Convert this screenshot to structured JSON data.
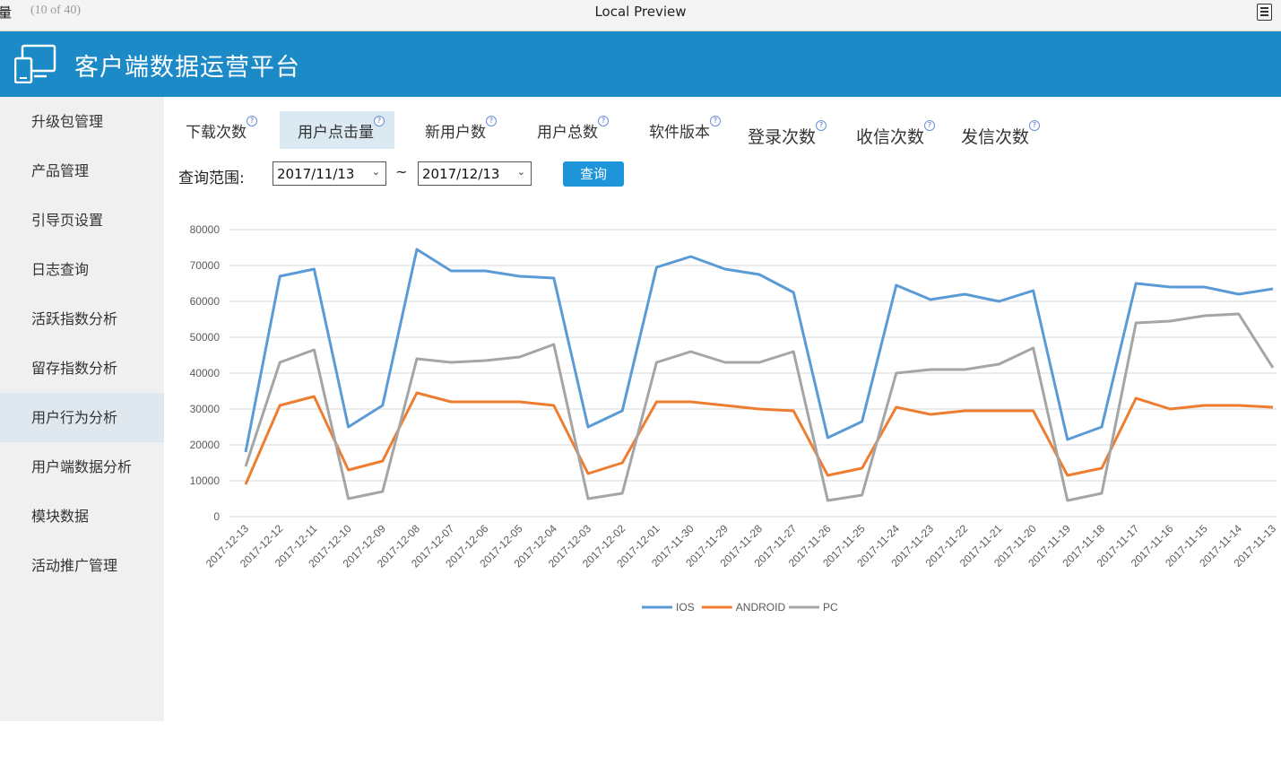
{
  "preview_bar": {
    "title_fragment": "量",
    "count": "(10 of 40)",
    "caption": "Local Preview",
    "menu_icon": "document-list-icon"
  },
  "header": {
    "title": "客户端数据运营平台",
    "icon": "devices-icon",
    "bg_color": "#1b8ac7"
  },
  "sidebar": {
    "items": [
      {
        "label": "升级包管理"
      },
      {
        "label": "产品管理"
      },
      {
        "label": "引导页设置"
      },
      {
        "label": "日志查询"
      },
      {
        "label": "活跃指数分析"
      },
      {
        "label": "留存指数分析"
      },
      {
        "label": "用户行为分析",
        "active": true
      },
      {
        "label": "用户端数据分析"
      },
      {
        "label": "模块数据"
      },
      {
        "label": "活动推广管理"
      }
    ]
  },
  "tabs": [
    {
      "label": "下载次数"
    },
    {
      "label": "用户点击量",
      "active": true
    },
    {
      "label": "新用户数"
    },
    {
      "label": "用户总数"
    },
    {
      "label": "软件版本"
    },
    {
      "label": "登录次数"
    },
    {
      "label": "收信次数"
    },
    {
      "label": "发信次数"
    }
  ],
  "query": {
    "label": "查询范围:",
    "start_date": "2017/11/13",
    "separator": "~",
    "end_date": "2017/12/13",
    "button": "查询"
  },
  "chart_data": {
    "type": "line",
    "title": "",
    "xlabel": "",
    "ylabel": "",
    "ylim": [
      0,
      80000
    ],
    "yticks": [
      "80000",
      "70000",
      "60000",
      "50000",
      "40000",
      "30000",
      "20000",
      "10000",
      "0"
    ],
    "grid": true,
    "legend_position": "bottom",
    "categories": [
      "2017-12-13",
      "2017-12-12",
      "2017-12-11",
      "2017-12-10",
      "2017-12-09",
      "2017-12-08",
      "2017-12-07",
      "2017-12-06",
      "2017-12-05",
      "2017-12-04",
      "2017-12-03",
      "2017-12-02",
      "2017-12-01",
      "2017-11-30",
      "2017-11-29",
      "2017-11-28",
      "2017-11-27",
      "2017-11-26",
      "2017-11-25",
      "2017-11-24",
      "2017-11-23",
      "2017-11-22",
      "2017-11-21",
      "2017-11-20",
      "2017-11-19",
      "2017-11-18",
      "2017-11-17",
      "2017-11-16",
      "2017-11-15",
      "2017-11-14",
      "2017-11-13"
    ],
    "series": [
      {
        "name": "IOS",
        "color": "#5b9bd5",
        "values": [
          18000,
          67000,
          69000,
          25000,
          31000,
          74500,
          68500,
          68500,
          67000,
          66500,
          25000,
          29500,
          69500,
          72500,
          69000,
          67500,
          62500,
          22000,
          26500,
          64500,
          60500,
          62000,
          60000,
          63000,
          21500,
          25000,
          65000,
          64000,
          64000,
          62000,
          63500
        ]
      },
      {
        "name": "ANDROID",
        "color": "#ed7d31",
        "values": [
          9000,
          31000,
          33500,
          13000,
          15500,
          34500,
          32000,
          32000,
          32000,
          31000,
          12000,
          15000,
          32000,
          32000,
          31000,
          30000,
          29500,
          11500,
          13500,
          30500,
          28500,
          29500,
          29500,
          29500,
          11500,
          13500,
          33000,
          30000,
          31000,
          31000,
          30500
        ]
      },
      {
        "name": "PC",
        "color": "#a5a5a5",
        "values": [
          14000,
          43000,
          46500,
          5000,
          7000,
          44000,
          43000,
          43500,
          44500,
          48000,
          5000,
          6500,
          43000,
          46000,
          43000,
          43000,
          46000,
          4500,
          6000,
          40000,
          41000,
          41000,
          42500,
          47000,
          4500,
          6500,
          54000,
          54500,
          56000,
          56500,
          41500
        ]
      }
    ]
  }
}
